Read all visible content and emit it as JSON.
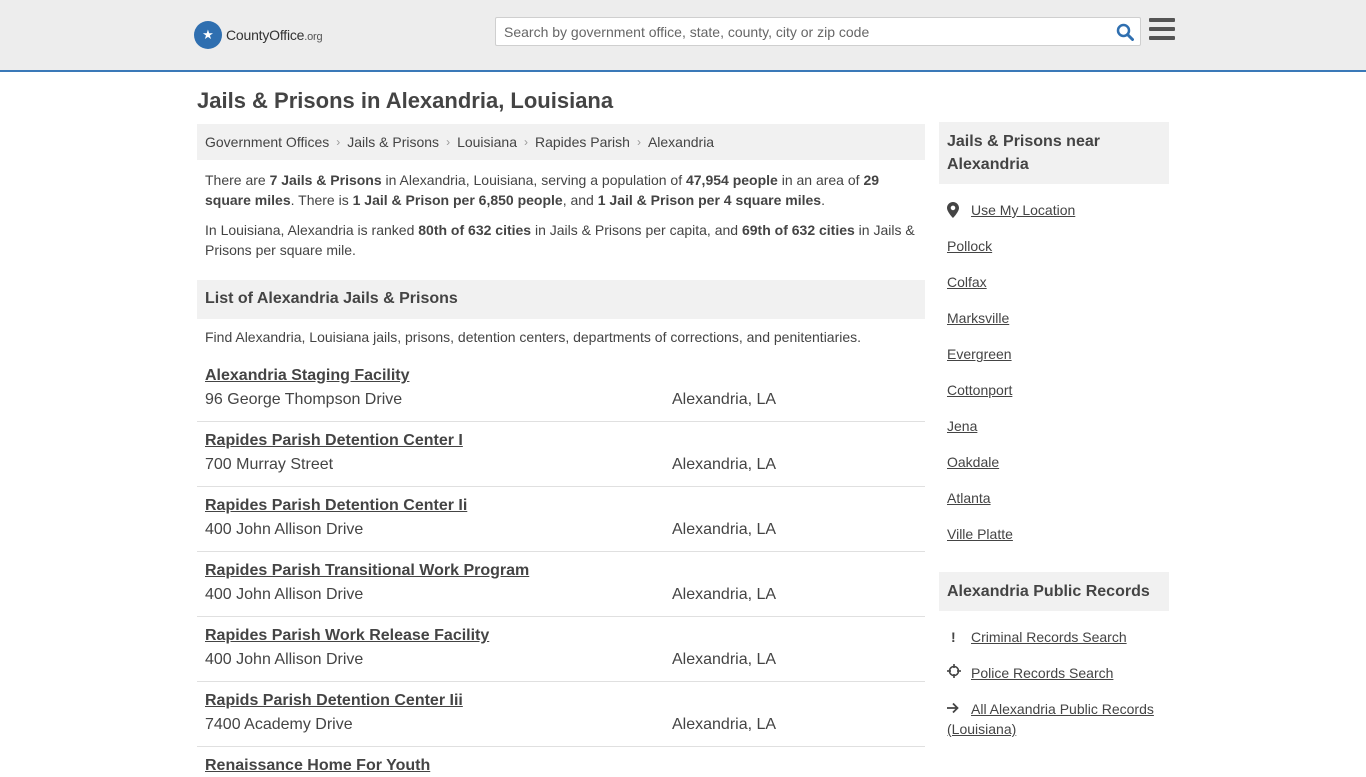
{
  "site": {
    "logo_name": "CountyOffice",
    "logo_tld": ".org"
  },
  "search": {
    "placeholder": "Search by government office, state, county, city or zip code"
  },
  "page_title": "Jails & Prisons in Alexandria, Louisiana",
  "breadcrumb": [
    "Government Offices",
    "Jails & Prisons",
    "Louisiana",
    "Rapides Parish",
    "Alexandria"
  ],
  "intro": {
    "p1": {
      "t1": "There are ",
      "b1": "7 Jails & Prisons",
      "t2": " in Alexandria, Louisiana, serving a population of ",
      "b2": "47,954 people",
      "t3": " in an area of ",
      "b3": "29 square miles",
      "t4": ". There is ",
      "b4": "1 Jail & Prison per 6,850 people",
      "t5": ", and ",
      "b5": "1 Jail & Prison per 4 square miles",
      "t6": "."
    },
    "p2": {
      "t1": "In Louisiana, Alexandria is ranked ",
      "b1": "80th of 632 cities",
      "t2": " in Jails & Prisons per capita, and ",
      "b2": "69th of 632 cities",
      "t3": " in Jails & Prisons per square mile."
    }
  },
  "list_header": "List of Alexandria Jails & Prisons",
  "list_desc": "Find Alexandria, Louisiana jails, prisons, detention centers, departments of corrections, and penitentiaries.",
  "listings": [
    {
      "name": "Alexandria Staging Facility",
      "address": "96 George Thompson Drive",
      "city": "Alexandria, LA"
    },
    {
      "name": "Rapides Parish Detention Center I",
      "address": "700 Murray Street",
      "city": "Alexandria, LA"
    },
    {
      "name": "Rapides Parish Detention Center Ii",
      "address": "400 John Allison Drive",
      "city": "Alexandria, LA"
    },
    {
      "name": "Rapides Parish Transitional Work Program",
      "address": "400 John Allison Drive",
      "city": "Alexandria, LA"
    },
    {
      "name": "Rapides Parish Work Release Facility",
      "address": "400 John Allison Drive",
      "city": "Alexandria, LA"
    },
    {
      "name": "Rapids Parish Detention Center Iii",
      "address": "7400 Academy Drive",
      "city": "Alexandria, LA"
    },
    {
      "name": "Renaissance Home For Youth",
      "address": "",
      "city": ""
    }
  ],
  "sidebar": {
    "nearby_title": "Jails & Prisons near Alexandria",
    "use_location": "Use My Location",
    "nearby": [
      "Pollock",
      "Colfax",
      "Marksville",
      "Evergreen",
      "Cottonport",
      "Jena",
      "Oakdale",
      "Atlanta",
      "Ville Platte"
    ],
    "records_title": "Alexandria Public Records",
    "records": {
      "criminal": "Criminal Records Search",
      "police": "Police Records Search",
      "all": "All Alexandria Public Records (Louisiana)"
    }
  },
  "colors": {
    "accent": "#3a79b8",
    "brand": "#2f6fb0",
    "panel": "#f1f1f1"
  }
}
